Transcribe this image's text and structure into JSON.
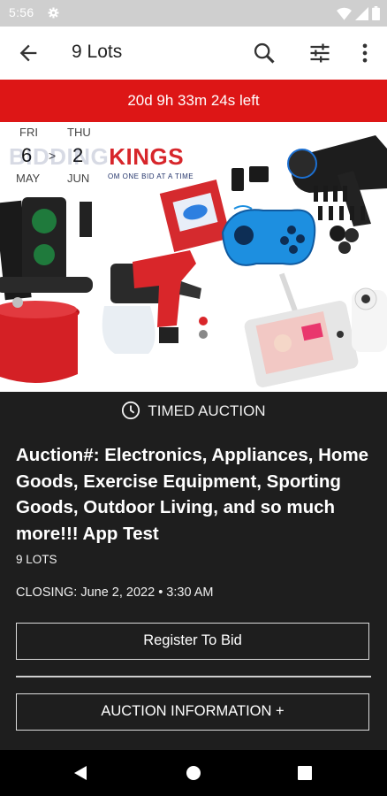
{
  "status_bar": {
    "time": "5:56",
    "icons": [
      "settings-gear-icon",
      "wifi-icon",
      "cell-signal-icon",
      "battery-icon"
    ]
  },
  "app_bar": {
    "title": "9 Lots",
    "icons": [
      "back-arrow-icon",
      "search-icon",
      "filter-sliders-icon",
      "more-vertical-icon"
    ]
  },
  "timer_banner": {
    "text": "20d 9h 33m 24s left",
    "color": "#dd1616"
  },
  "hero": {
    "date_range": {
      "start_day": "FRI",
      "start_date": "6",
      "start_month": "MAY",
      "arrow": ">",
      "end_day": "THU",
      "end_date": "2",
      "end_month": "JUN"
    },
    "logo": {
      "part1": "BIDDING",
      "part2": "KINGS",
      "tagline": "OM  ONE  BID AT A TIME"
    }
  },
  "auction": {
    "type_label": "TIMED AUCTION",
    "title": "Auction#: Electronics, Appliances, Home Goods, Exercise Equipment, Sporting Goods, Outdoor Living, and so much more!!! App Test",
    "lots_count": "9 LOTS",
    "closing": "CLOSING: June 2, 2022 • 3:30 AM",
    "register_button": "Register To Bid",
    "info_button": "AUCTION INFORMATION +"
  },
  "colors": {
    "accent_red": "#dd1616",
    "dark_bg": "#1e1e1e",
    "logo_red": "#d7262b",
    "logo_navy": "#23346b"
  },
  "nav_bar": {
    "icons": [
      "back-triangle-icon",
      "home-circle-icon",
      "recents-square-icon"
    ]
  }
}
